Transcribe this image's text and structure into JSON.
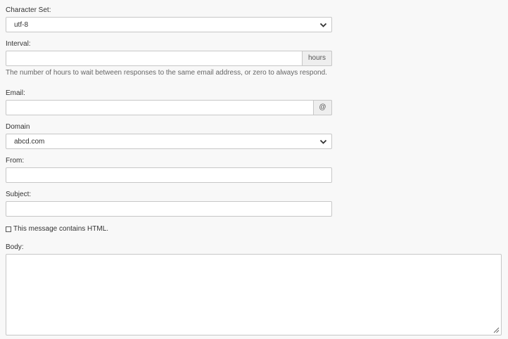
{
  "charset": {
    "label": "Character Set:",
    "value": "utf-8"
  },
  "interval": {
    "label": "Interval:",
    "value": "",
    "addon": "hours",
    "help": "The number of hours to wait between responses to the same email address, or zero to always respond."
  },
  "email": {
    "label": "Email:",
    "value": "",
    "addon": "@"
  },
  "domain": {
    "label": "Domain",
    "value": "abcd.com"
  },
  "from": {
    "label": "From:",
    "value": ""
  },
  "subject": {
    "label": "Subject:",
    "value": ""
  },
  "html_checkbox": {
    "label": "This message contains HTML.",
    "checked": false
  },
  "body": {
    "label": "Body:",
    "value": ""
  },
  "icons": {
    "dropdown": "chevron-down-icon",
    "resize": "resize-grip-icon"
  }
}
